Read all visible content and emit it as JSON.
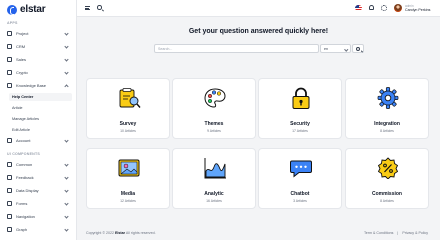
{
  "app": {
    "name": "elstar"
  },
  "sidebar": {
    "apps_label": "APPS",
    "items": [
      {
        "label": "Project"
      },
      {
        "label": "CRM"
      },
      {
        "label": "Sales"
      },
      {
        "label": "Crypto"
      },
      {
        "label": "Knowledge Base"
      }
    ],
    "subitems": [
      {
        "label": "Help Center",
        "active": true
      },
      {
        "label": "Article"
      },
      {
        "label": "Manage Articles"
      },
      {
        "label": "Edit Article"
      }
    ],
    "account": {
      "label": "Account"
    },
    "ui_label": "UI COMPONENTS",
    "ui_items": [
      {
        "label": "Common"
      },
      {
        "label": "Feedback"
      },
      {
        "label": "Data Display"
      },
      {
        "label": "Forms"
      },
      {
        "label": "Navigation"
      },
      {
        "label": "Graph"
      }
    ]
  },
  "header": {
    "user_role": "admin",
    "user_name": "Carolyn Perkins"
  },
  "main": {
    "headline": "Get your question answered quickly here!",
    "search_placeholder": "Search...",
    "language": "en",
    "categories": [
      {
        "title": "Survey",
        "count": "10 Articles",
        "icon": "survey-icon"
      },
      {
        "title": "Themes",
        "count": "9 Articles",
        "icon": "palette-icon"
      },
      {
        "title": "Security",
        "count": "17 Articles",
        "icon": "lock-icon"
      },
      {
        "title": "Integration",
        "count": "8 Articles",
        "icon": "gear-icon"
      },
      {
        "title": "Media",
        "count": "12 Articles",
        "icon": "image-icon"
      },
      {
        "title": "Analytic",
        "count": "16 Articles",
        "icon": "chart-icon"
      },
      {
        "title": "Chatbot",
        "count": "3 Articles",
        "icon": "chat-icon"
      },
      {
        "title": "Commission",
        "count": "8 Articles",
        "icon": "percent-icon"
      }
    ]
  },
  "footer": {
    "copyright": "Copyright © 2022",
    "brand": "Elstar",
    "rights": "All rights reserved.",
    "terms": "Term & Conditions",
    "privacy": "Privacy & Policy"
  },
  "colors": {
    "accent": "#2563eb",
    "yellow": "#facc15",
    "blue": "#3b82f6",
    "sky": "#60a5fa"
  }
}
